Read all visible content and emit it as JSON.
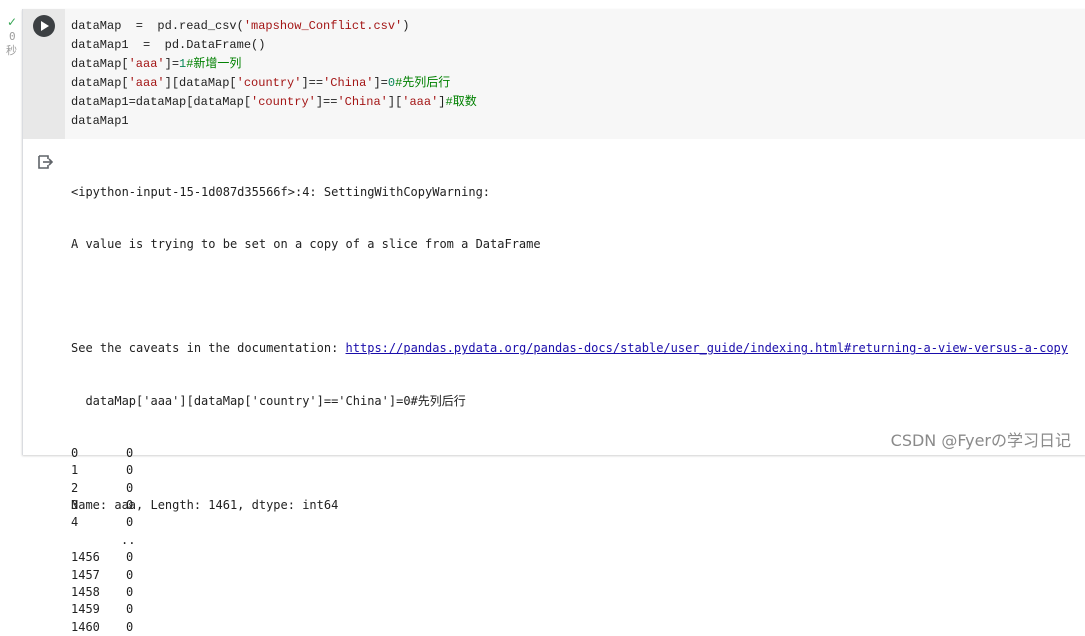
{
  "execution": {
    "status_symbol": "✓",
    "count": "0",
    "unit": "秒"
  },
  "code_lines": [
    [
      {
        "t": "dataMap  =  pd.read_csv(",
        "c": ""
      },
      {
        "t": "'mapshow_Conflict.csv'",
        "c": "str"
      },
      {
        "t": ")",
        "c": ""
      }
    ],
    [
      {
        "t": "dataMap1  =  pd.DataFrame()",
        "c": ""
      }
    ],
    [
      {
        "t": "dataMap[",
        "c": ""
      },
      {
        "t": "'aaa'",
        "c": "str"
      },
      {
        "t": "]=",
        "c": ""
      },
      {
        "t": "1",
        "c": "num"
      },
      {
        "t": "#新增一列",
        "c": "com"
      }
    ],
    [
      {
        "t": "dataMap[",
        "c": ""
      },
      {
        "t": "'aaa'",
        "c": "str"
      },
      {
        "t": "][dataMap[",
        "c": ""
      },
      {
        "t": "'country'",
        "c": "str"
      },
      {
        "t": "]==",
        "c": ""
      },
      {
        "t": "'China'",
        "c": "str"
      },
      {
        "t": "]=",
        "c": ""
      },
      {
        "t": "0",
        "c": "num"
      },
      {
        "t": "#先列后行",
        "c": "com"
      }
    ],
    [
      {
        "t": "dataMap1=dataMap[dataMap[",
        "c": ""
      },
      {
        "t": "'country'",
        "c": "str"
      },
      {
        "t": "]==",
        "c": ""
      },
      {
        "t": "'China'",
        "c": "str"
      },
      {
        "t": "][",
        "c": ""
      },
      {
        "t": "'aaa'",
        "c": "str"
      },
      {
        "t": "]",
        "c": ""
      },
      {
        "t": "#取数",
        "c": "com"
      }
    ],
    [
      {
        "t": "dataMap1",
        "c": ""
      }
    ]
  ],
  "output": {
    "warning_line1": "<ipython-input-15-1d087d35566f>:4: SettingWithCopyWarning:",
    "warning_line2": "A value is trying to be set on a copy of a slice from a DataFrame",
    "caveats_prefix": "See the caveats in the documentation: ",
    "caveats_link": "https://pandas.pydata.org/pandas-docs/stable/user_guide/indexing.html#returning-a-view-versus-a-copy",
    "source_line": "  dataMap['aaa'][dataMap['country']=='China']=0#先列后行",
    "series_rows": [
      {
        "index": "0",
        "value": "0"
      },
      {
        "index": "1",
        "value": "0"
      },
      {
        "index": "2",
        "value": "0"
      },
      {
        "index": "3",
        "value": "0"
      },
      {
        "index": "4",
        "value": "0"
      },
      {
        "index": "",
        "value": "..",
        "ellipsis": true
      },
      {
        "index": "1456",
        "value": "0"
      },
      {
        "index": "1457",
        "value": "0"
      },
      {
        "index": "1458",
        "value": "0"
      },
      {
        "index": "1459",
        "value": "0"
      },
      {
        "index": "1460",
        "value": "0"
      }
    ],
    "summary": "Name: aaa, Length: 1461, dtype: int64"
  },
  "watermark": "CSDN @Fyerの学习日记"
}
